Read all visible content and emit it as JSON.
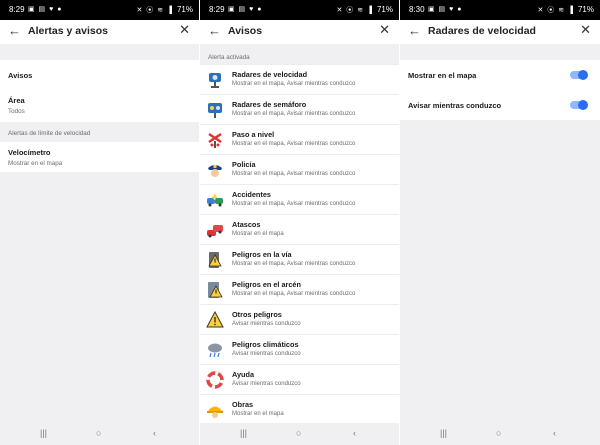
{
  "status": {
    "p1": {
      "time": "8:29",
      "battery": "71%"
    },
    "p2": {
      "time": "8:29",
      "battery": "71%"
    },
    "p3": {
      "time": "8:30",
      "battery": "71%"
    }
  },
  "panel1": {
    "title": "Alertas y avisos",
    "rows": [
      {
        "title": "Avisos"
      },
      {
        "title": "Área",
        "subtitle": "Todos"
      }
    ],
    "section_label": "Alertas de límite de velocidad",
    "speedo": {
      "title": "Velocímetro",
      "subtitle": "Mostrar en el mapa"
    }
  },
  "panel2": {
    "title": "Avisos",
    "section_label": "Alerta activada",
    "items": [
      {
        "title": "Radares de velocidad",
        "subtitle": "Mostrar en el mapa, Avisar mientras conduzco",
        "icon": "speed-camera-icon"
      },
      {
        "title": "Radares de semáforo",
        "subtitle": "Mostrar en el mapa, Avisar mientras conduzco",
        "icon": "traffic-light-camera-icon"
      },
      {
        "title": "Paso a nivel",
        "subtitle": "Mostrar en el mapa, Avisar mientras conduzco",
        "icon": "railroad-crossing-icon"
      },
      {
        "title": "Policía",
        "subtitle": "Mostrar en el mapa, Avisar mientras conduzco",
        "icon": "police-icon"
      },
      {
        "title": "Accidentes",
        "subtitle": "Mostrar en el mapa, Avisar mientras conduzco",
        "icon": "accident-icon"
      },
      {
        "title": "Atascos",
        "subtitle": "Mostrar en el mapa",
        "icon": "traffic-jam-icon"
      },
      {
        "title": "Peligros en la vía",
        "subtitle": "Mostrar en el mapa, Avisar mientras conduzco",
        "icon": "road-hazard-icon"
      },
      {
        "title": "Peligros en el arcén",
        "subtitle": "Mostrar en el mapa, Avisar mientras conduzco",
        "icon": "shoulder-hazard-icon"
      },
      {
        "title": "Otros peligros",
        "subtitle": "Avisar mientras conduzco",
        "icon": "warning-icon"
      },
      {
        "title": "Peligros climáticos",
        "subtitle": "Avisar mientras conduzco",
        "icon": "weather-icon"
      },
      {
        "title": "Ayuda",
        "subtitle": "Avisar mientras conduzco",
        "icon": "lifebuoy-icon"
      },
      {
        "title": "Obras",
        "subtitle": "Mostrar en el mapa",
        "icon": "construction-icon"
      }
    ]
  },
  "panel3": {
    "title": "Radares de velocidad",
    "toggles": [
      {
        "label": "Mostrar en el mapa",
        "on": true
      },
      {
        "label": "Avisar mientras conduzco",
        "on": true
      }
    ]
  },
  "colors": {
    "toggle_on": "#2a6df4",
    "toggle_track": "#8fb8ff",
    "background": "#f0f0f3"
  }
}
